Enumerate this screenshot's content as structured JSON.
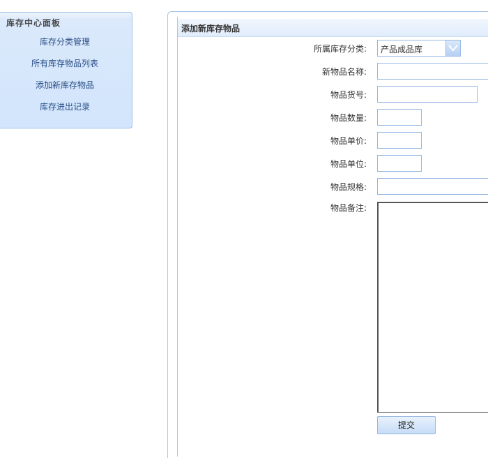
{
  "sidebar": {
    "title": "库存中心面板",
    "items": [
      {
        "label": "库存分类管理"
      },
      {
        "label": "所有库存物品列表"
      },
      {
        "label": "添加新库存物品"
      },
      {
        "label": "库存进出记录"
      }
    ]
  },
  "form": {
    "title": "添加新库存物品",
    "category_label": "所属库存分类:",
    "category_value": "产品成品库",
    "name_label": "新物品名称:",
    "sku_label": "物品货号:",
    "quantity_label": "物品数量:",
    "unit_price_label": "物品单价:",
    "unit_label": "物品单位:",
    "spec_label": "物品规格:",
    "note_label": "物品备注:",
    "submit_label": "提交"
  },
  "icons": {
    "dropdown": "chevron-down-icon"
  },
  "colors": {
    "panel_border": "#9cbfe6",
    "panel_bg": "#d2e5fc",
    "link": "#2a4f86"
  }
}
